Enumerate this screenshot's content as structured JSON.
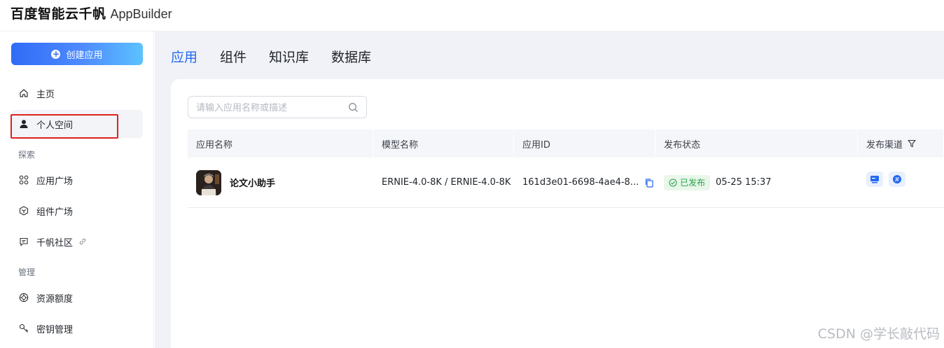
{
  "header": {
    "brand_cn": "百度智能云千帆",
    "brand_en": "AppBuilder"
  },
  "sidebar": {
    "create_label": "创建应用",
    "items_top": [
      {
        "label": "主页",
        "icon": "home-icon"
      },
      {
        "label": "个人空间",
        "icon": "user-icon",
        "active": true
      }
    ],
    "section_explore": "探索",
    "items_explore": [
      {
        "label": "应用广场",
        "icon": "grid-icon"
      },
      {
        "label": "组件广场",
        "icon": "hexagon-icon"
      },
      {
        "label": "千帆社区",
        "icon": "chat-icon"
      }
    ],
    "section_manage": "管理",
    "items_manage": [
      {
        "label": "资源额度",
        "icon": "ring-icon"
      },
      {
        "label": "密钥管理",
        "icon": "key-icon"
      }
    ]
  },
  "tabs": [
    {
      "label": "应用",
      "active": true
    },
    {
      "label": "组件"
    },
    {
      "label": "知识库"
    },
    {
      "label": "数据库"
    }
  ],
  "search": {
    "placeholder": "请输入应用名称或描述",
    "value": ""
  },
  "table": {
    "headers": [
      "应用名称",
      "模型名称",
      "应用ID",
      "发布状态",
      "发布渠道"
    ],
    "rows": [
      {
        "name": "论文小助手",
        "model": "ERNIE-4.0-8K / ERNIE-4.0-8K",
        "app_id": "161d3e01-6698-4ae4-8...",
        "status": "已发布",
        "time": "05-25 15:37"
      }
    ]
  },
  "watermark": "CSDN @学长敲代码",
  "colors": {
    "accent": "#2468f2",
    "success": "#2ba14a",
    "highlight": "#e02020"
  }
}
